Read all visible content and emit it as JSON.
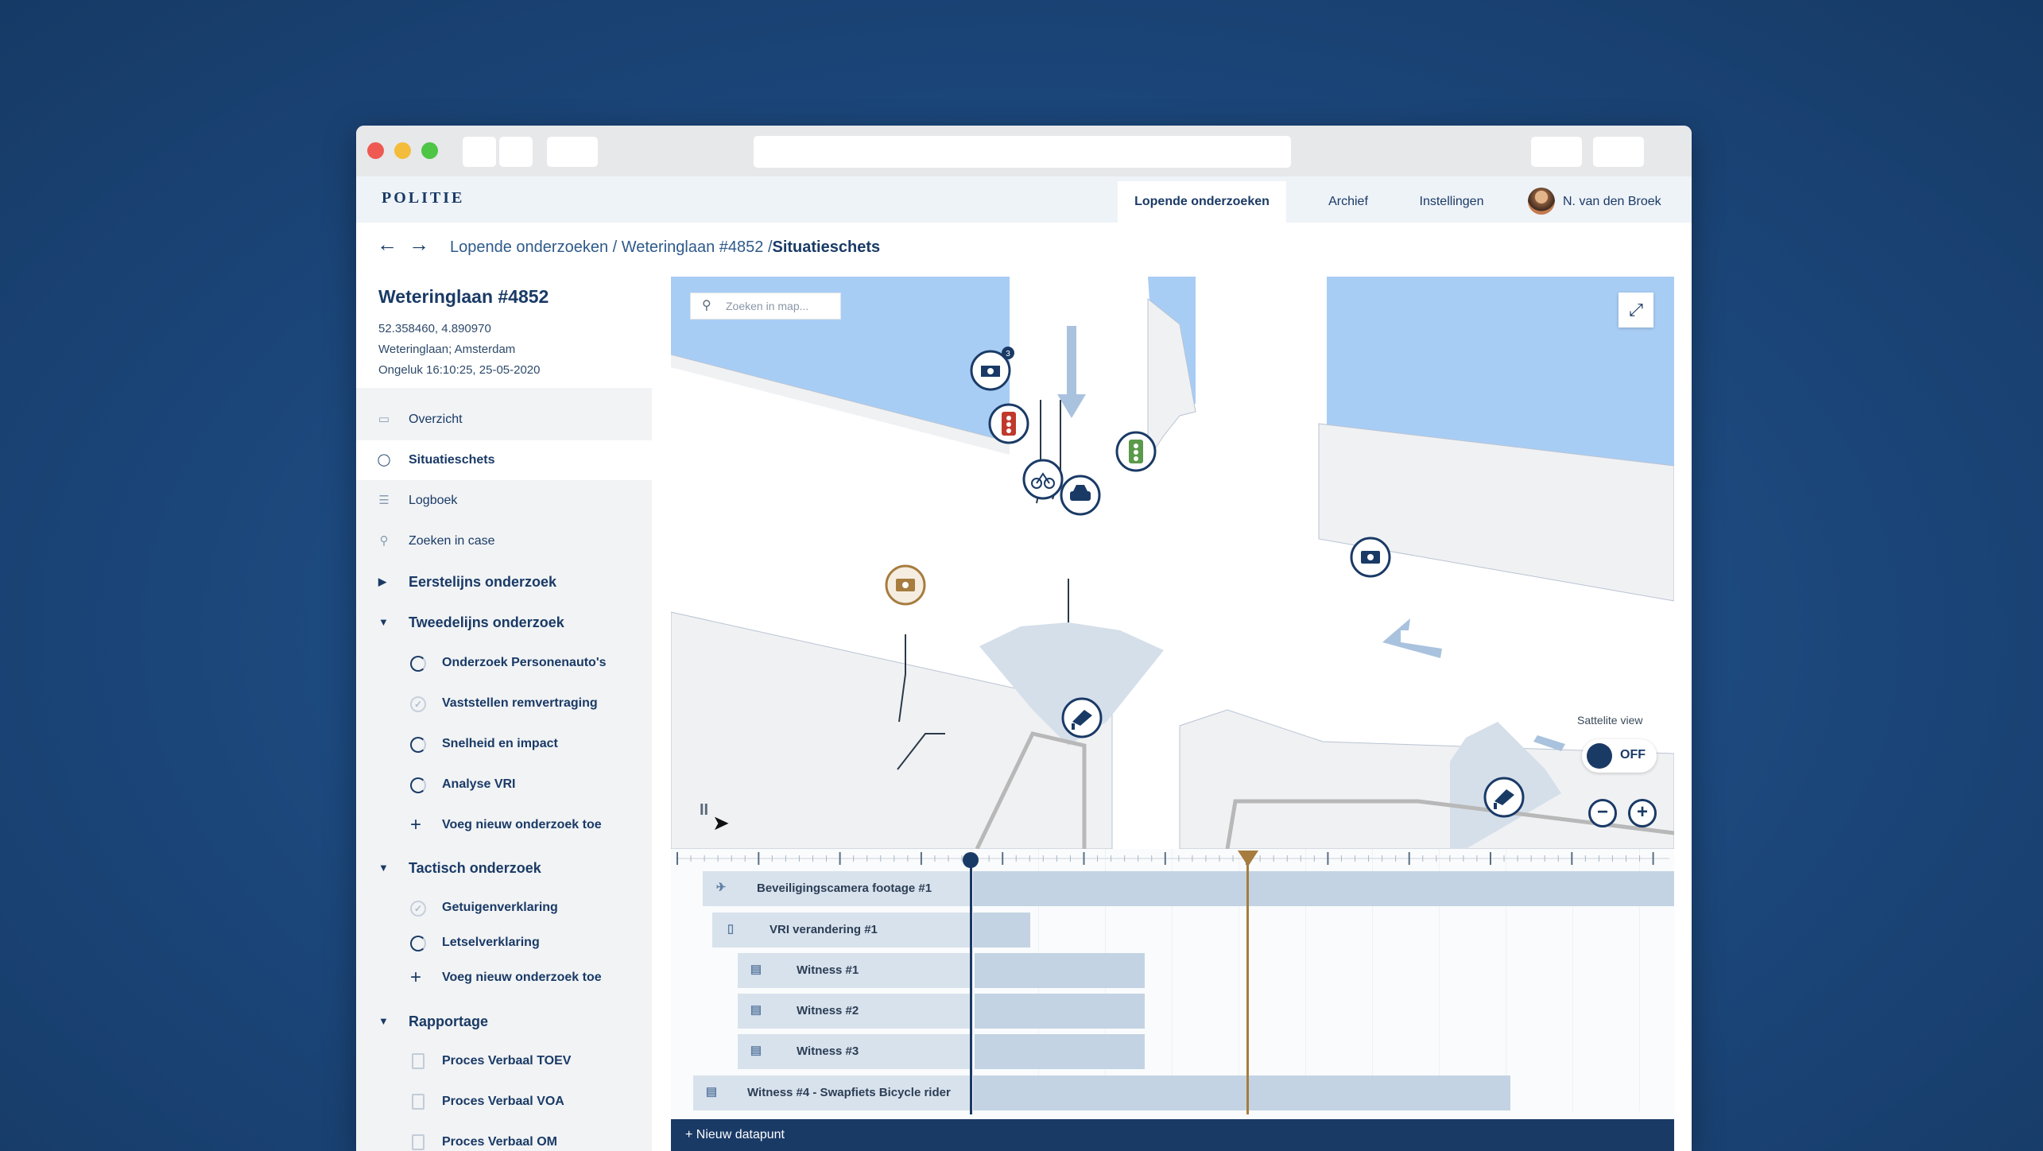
{
  "nav": {
    "logo": "POLITIE",
    "tabs": [
      {
        "label": "Lopende onderzoeken"
      },
      {
        "label": "Archief"
      },
      {
        "label": "Instellingen"
      }
    ],
    "user": "N. van den Broek"
  },
  "breadcrumb": {
    "path": "Lopende onderzoeken / Weteringlaan #4852 /",
    "current": "Situatieschets"
  },
  "case": {
    "title": "Weteringlaan #4852",
    "coords": "52.358460, 4.890970",
    "location": "Weteringlaan; Amsterdam",
    "incident": "Ongeluk 16:10:25, 25-05-2020"
  },
  "sidebar": {
    "items": [
      {
        "label": "Overzicht",
        "icon": "map-icon"
      },
      {
        "label": "Situatieschets",
        "icon": "play-icon"
      },
      {
        "label": "Logboek",
        "icon": "list-icon"
      },
      {
        "label": "Zoeken in case",
        "icon": "search-icon"
      }
    ],
    "sections": [
      {
        "label": "Eerstelijns onderzoek",
        "expanded": false
      },
      {
        "label": "Tweedelijns onderzoek",
        "expanded": true,
        "children": [
          {
            "label": "Onderzoek Personenauto's"
          },
          {
            "label": "Vaststellen remvertraging"
          },
          {
            "label": "Snelheid en impact"
          },
          {
            "label": "Analyse VRI"
          },
          {
            "label": "Voeg nieuw onderzoek toe"
          }
        ]
      },
      {
        "label": "Tactisch onderzoek",
        "expanded": true,
        "children": [
          {
            "label": "Getuigenverklaring"
          },
          {
            "label": "Letselverklaring"
          },
          {
            "label": "Voeg nieuw onderzoek toe"
          }
        ]
      },
      {
        "label": "Rapportage",
        "expanded": true,
        "children": [
          {
            "label": "Proces Verbaal TOEV"
          },
          {
            "label": "Proces Verbaal VOA"
          },
          {
            "label": "Proces Verbaal OM"
          }
        ]
      }
    ]
  },
  "map": {
    "search_placeholder": "Zoeken in map...",
    "satellite_label": "Sattelite view",
    "satellite_state": "OFF",
    "marker_badge": "3",
    "colors": {
      "water": "#a8cdf5",
      "road": "#ffffff",
      "block": "#f0f1f3",
      "accent": "#1a3a66",
      "gold": "#a67c3f",
      "red": "#c0392b",
      "green": "#5a9a4a"
    }
  },
  "timeline": {
    "rows": [
      {
        "label": "Beveiligingscamera footage #1",
        "icon": "camera-icon"
      },
      {
        "label": "VRI verandering #1",
        "icon": "traffic-light-icon"
      },
      {
        "label": "Witness #1",
        "icon": "chat-icon"
      },
      {
        "label": "Witness #2",
        "icon": "chat-icon"
      },
      {
        "label": "Witness #3",
        "icon": "chat-icon"
      },
      {
        "label": "Witness #4 - Swapfiets Bicycle rider",
        "icon": "chat-icon"
      }
    ],
    "new_label": "+ Nieuw datapunt"
  }
}
